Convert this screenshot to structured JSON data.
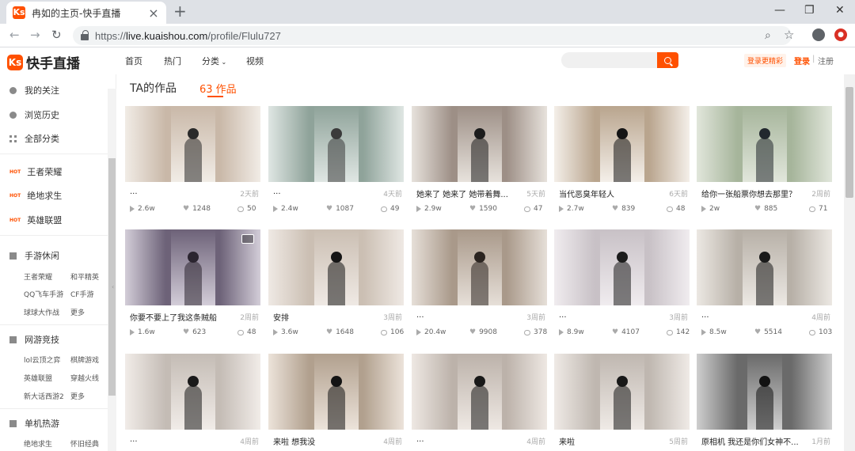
{
  "browser": {
    "tab_title": "冉如的主页-快手直播",
    "url_host": "live.kuaishou.com",
    "url_path": "/profile/Flulu727",
    "url_scheme": "https://"
  },
  "site": {
    "logo_text": "快手直播",
    "logo_mark": "Ks",
    "nav": [
      "首页",
      "热门",
      "分类",
      "视频"
    ],
    "promo": "登录更精彩",
    "login": "登录",
    "separator": "|",
    "register": "注册",
    "brand_color": "#ff5000"
  },
  "sidebar": {
    "top_items": [
      {
        "label": "我的关注",
        "icon": "shield-icon"
      },
      {
        "label": "浏览历史",
        "icon": "clock-icon"
      },
      {
        "label": "全部分类",
        "icon": "grid-icon"
      }
    ],
    "hot_badge": "HOT",
    "hot_items": [
      "王者荣耀",
      "绝地求生",
      "英雄联盟"
    ],
    "sections": [
      {
        "title": "手游休闲",
        "icon": "mobile-game-icon",
        "links": [
          "王者荣耀",
          "和平精英",
          "QQ飞车手游",
          "CF手游",
          "球球大作战",
          "更多"
        ]
      },
      {
        "title": "网游竞技",
        "icon": "online-game-icon",
        "links": [
          "lol云顶之弈",
          "棋牌游戏",
          "英雄联盟",
          "穿越火线",
          "新大话西游2",
          "更多"
        ]
      },
      {
        "title": "单机热游",
        "icon": "console-game-icon",
        "links": [
          "绝地求生",
          "怀旧经典"
        ]
      }
    ]
  },
  "main": {
    "section_title": "TA的作品",
    "works_count": "63 作品",
    "videos": [
      {
        "title": "...",
        "time": "2天前",
        "plays": "2.6w",
        "likes": "1248",
        "comments": "50"
      },
      {
        "title": "...",
        "time": "4天前",
        "plays": "2.4w",
        "likes": "1087",
        "comments": "49"
      },
      {
        "title": "她来了 她来了 她带着舞...",
        "time": "5天前",
        "plays": "2.9w",
        "likes": "1590",
        "comments": "47"
      },
      {
        "title": "当代恶臭年轻人",
        "time": "6天前",
        "plays": "2.7w",
        "likes": "839",
        "comments": "48"
      },
      {
        "title": "给你一张船票你想去那里？",
        "time": "2周前",
        "plays": "2w",
        "likes": "885",
        "comments": "71"
      },
      {
        "title": "你要不要上了我这条贼船",
        "time": "2周前",
        "plays": "1.6w",
        "likes": "623",
        "comments": "48"
      },
      {
        "title": "安排",
        "time": "3周前",
        "plays": "3.6w",
        "likes": "1648",
        "comments": "106"
      },
      {
        "title": "...",
        "time": "3周前",
        "plays": "20.4w",
        "likes": "9908",
        "comments": "378"
      },
      {
        "title": "...",
        "time": "3周前",
        "plays": "8.9w",
        "likes": "4107",
        "comments": "142"
      },
      {
        "title": "...",
        "time": "4周前",
        "plays": "8.5w",
        "likes": "5514",
        "comments": "103"
      },
      {
        "title": "...",
        "time": "4周前",
        "plays": "",
        "likes": "",
        "comments": ""
      },
      {
        "title": "来啦 想我没",
        "time": "4周前",
        "plays": "",
        "likes": "",
        "comments": ""
      },
      {
        "title": "...",
        "time": "4周前",
        "plays": "",
        "likes": "",
        "comments": ""
      },
      {
        "title": "来啦",
        "time": "5周前",
        "plays": "",
        "likes": "",
        "comments": ""
      },
      {
        "title": "原相机 我还是你们女神不...",
        "time": "1月前",
        "plays": "",
        "likes": "",
        "comments": ""
      }
    ]
  }
}
